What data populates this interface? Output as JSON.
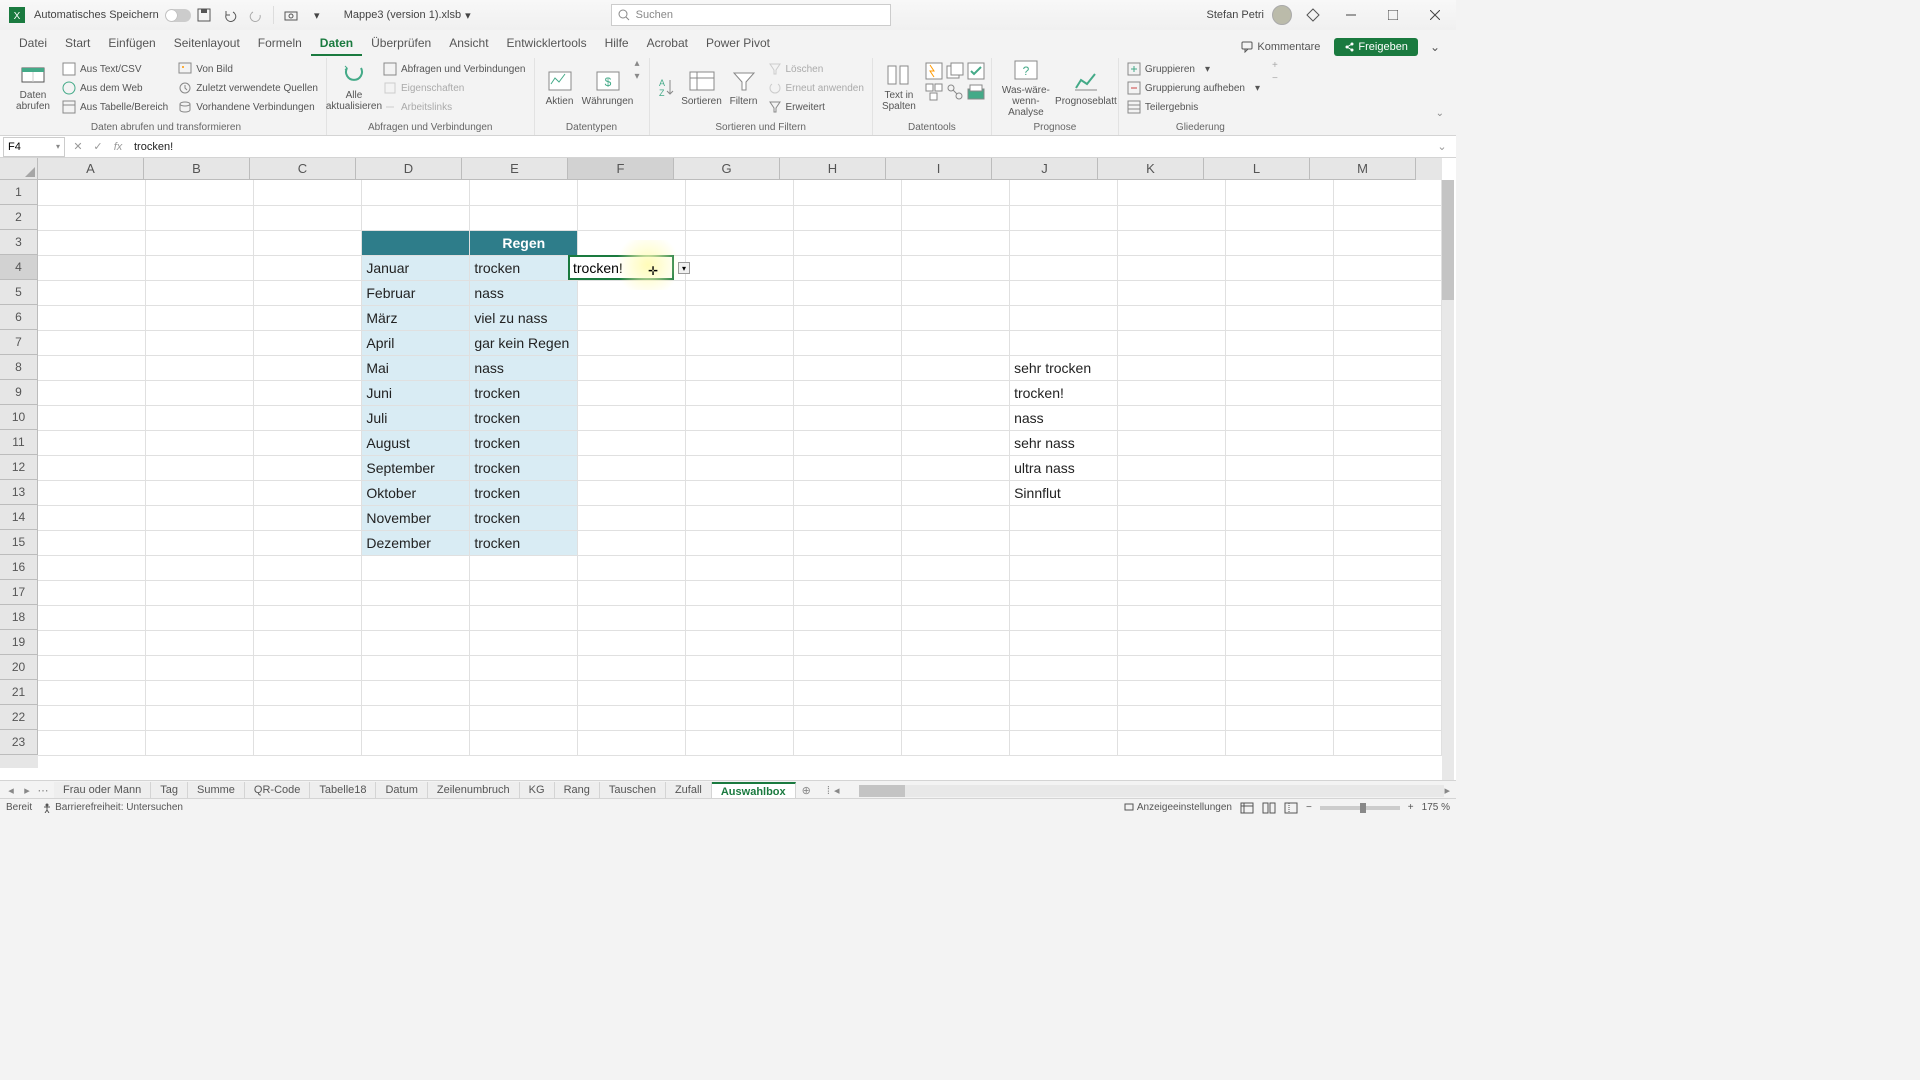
{
  "title_bar": {
    "autosave_label": "Automatisches Speichern",
    "filename": "Mappe3 (version 1).xlsb",
    "search_placeholder": "Suchen",
    "username": "Stefan Petri"
  },
  "ribbon_tabs": {
    "items": [
      "Datei",
      "Start",
      "Einfügen",
      "Seitenlayout",
      "Formeln",
      "Daten",
      "Überprüfen",
      "Ansicht",
      "Entwicklertools",
      "Hilfe",
      "Acrobat",
      "Power Pivot"
    ],
    "active": "Daten",
    "comments": "Kommentare",
    "share": "Freigeben"
  },
  "ribbon": {
    "g1_label": "Daten abrufen und transformieren",
    "g1_big": "Daten abrufen",
    "g1_s1": "Aus Text/CSV",
    "g1_s2": "Aus dem Web",
    "g1_s3": "Aus Tabelle/Bereich",
    "g1_s4": "Von Bild",
    "g1_s5": "Zuletzt verwendete Quellen",
    "g1_s6": "Vorhandene Verbindungen",
    "g2_label": "Abfragen und Verbindungen",
    "g2_big": "Alle aktualisieren",
    "g2_s1": "Abfragen und Verbindungen",
    "g2_s2": "Eigenschaften",
    "g2_s3": "Arbeitslinks",
    "g3_label": "Datentypen",
    "g3_b1": "Aktien",
    "g3_b2": "Währungen",
    "g4_label": "Sortieren und Filtern",
    "g4_b1": "Sortieren",
    "g4_b2": "Filtern",
    "g4_s1": "Löschen",
    "g4_s2": "Erneut anwenden",
    "g4_s3": "Erweitert",
    "g5_label": "Datentools",
    "g5_b1": "Text in Spalten",
    "g6_label": "Prognose",
    "g6_b1": "Was-wäre-wenn-Analyse",
    "g6_b2": "Prognoseblatt",
    "g7_label": "Gliederung",
    "g7_s1": "Gruppieren",
    "g7_s2": "Gruppierung aufheben",
    "g7_s3": "Teilergebnis"
  },
  "formula_bar": {
    "name_box": "F4",
    "formula": "trocken!"
  },
  "grid": {
    "columns": [
      "A",
      "B",
      "C",
      "D",
      "E",
      "F",
      "G",
      "H",
      "I",
      "J",
      "K",
      "L",
      "M"
    ],
    "active_col": "F",
    "active_row": 4,
    "header_cell": "Regen",
    "months": [
      "Januar",
      "Februar",
      "März",
      "April",
      "Mai",
      "Juni",
      "Juli",
      "August",
      "September",
      "Oktober",
      "November",
      "Dezember"
    ],
    "values": [
      "trocken",
      "nass",
      "viel zu nass",
      "gar kein Regen",
      "nass",
      "trocken",
      "trocken",
      "trocken",
      "trocken",
      "trocken",
      "trocken",
      "trocken"
    ],
    "selected_value": "trocken!",
    "list_j": [
      "sehr trocken",
      "trocken!",
      "nass",
      "sehr nass",
      "ultra nass",
      "Sinnflut"
    ]
  },
  "sheet_tabs": {
    "items": [
      "Frau oder Mann",
      "Tag",
      "Summe",
      "QR-Code",
      "Tabelle18",
      "Datum",
      "Zeilenumbruch",
      "KG",
      "Rang",
      "Tauschen",
      "Zufall",
      "Auswahlbox"
    ],
    "active": "Auswahlbox"
  },
  "status_bar": {
    "ready": "Bereit",
    "accessibility": "Barrierefreiheit: Untersuchen",
    "display_settings": "Anzeigeeinstellungen",
    "zoom": "175 %"
  },
  "chart_data": {
    "type": "table",
    "title": "Regen",
    "categories": [
      "Januar",
      "Februar",
      "März",
      "April",
      "Mai",
      "Juni",
      "Juli",
      "August",
      "September",
      "Oktober",
      "November",
      "Dezember"
    ],
    "values": [
      "trocken",
      "nass",
      "viel zu nass",
      "gar kein Regen",
      "nass",
      "trocken",
      "trocken",
      "trocken",
      "trocken",
      "trocken",
      "trocken",
      "trocken"
    ]
  }
}
